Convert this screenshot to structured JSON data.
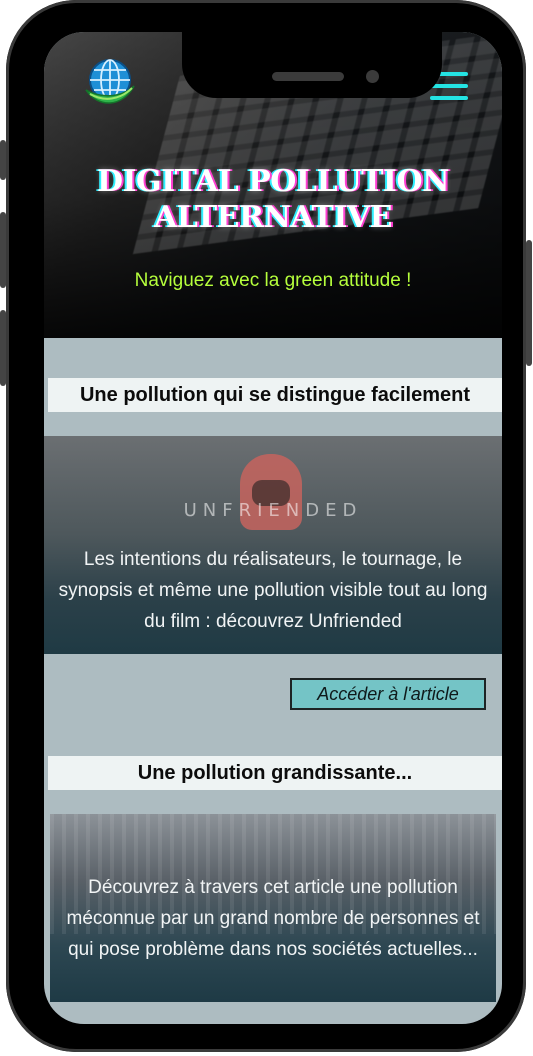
{
  "hero": {
    "title_line1": "DIGITAL POLLUTION",
    "title_line2": "ALTERNATIVE",
    "tagline": "Naviguez avec la green attitude !"
  },
  "nav": {
    "logo_icon": "globe-leaf-logo-icon",
    "menu_icon": "hamburger-menu-icon"
  },
  "articles": [
    {
      "title": "Une pollution qui se distingue facilement",
      "image_text": "UNFRIENDED",
      "summary": "Les intentions du réalisateurs, le tournage, le synopsis et même une pollution visible tout au long du film : découvrez Unfriended",
      "cta": "Accéder à l'article"
    },
    {
      "title": "Une pollution grandissante...",
      "summary": "Découvrez à travers cet article une pollution méconnue par un grand nombre de personnes et qui pose problème dans nos sociétés actuelles..."
    }
  ],
  "colors": {
    "accent_cyan": "#24e3e3",
    "tagline_green": "#b6ff3c",
    "cta_background": "#74c4c6",
    "page_background": "#adbcc1"
  }
}
